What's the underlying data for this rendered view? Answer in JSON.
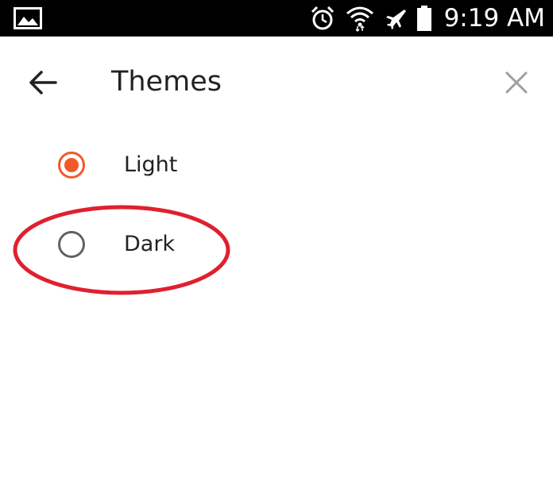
{
  "status_bar": {
    "time": "9:19 AM",
    "icons": [
      "image-icon",
      "alarm-icon",
      "wifi-icon",
      "airplane-icon",
      "battery-icon"
    ]
  },
  "header": {
    "title": "Themes",
    "back_icon": "arrow-left-icon",
    "close_icon": "close-icon"
  },
  "themes": {
    "options": [
      {
        "label": "Light",
        "selected": true
      },
      {
        "label": "Dark",
        "selected": false
      }
    ]
  },
  "colors": {
    "accent": "#F05A28",
    "radio_unselected": "#5F6368",
    "annotation": "#E0202E",
    "status_bar_bg": "#000000",
    "close_icon": "#9E9E9E"
  }
}
